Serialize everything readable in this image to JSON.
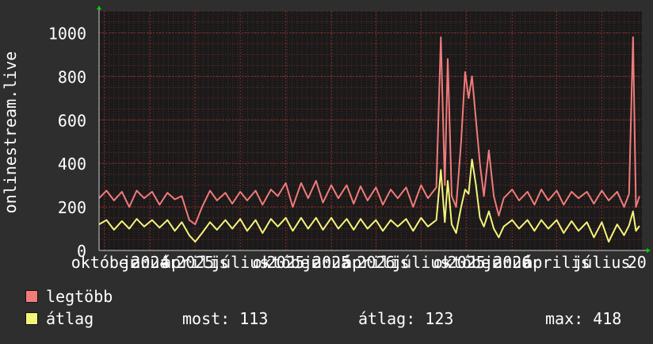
{
  "chart_data": {
    "type": "line",
    "ylabel": "onlinestream.live",
    "ylim": [
      0,
      1100
    ],
    "yticks": [
      0,
      200,
      400,
      600,
      800,
      1000
    ],
    "xlim": [
      "2023-09-20",
      "2026-09-20"
    ],
    "xtick_labels": [
      {
        "date": "2023-10-01",
        "label": "október"
      },
      {
        "date": "2024-01-01",
        "label": "január"
      },
      {
        "date": "2024-04-01",
        "label": "április"
      },
      {
        "date": "2024-07-01",
        "label": "július"
      },
      {
        "date": "2024-10-01",
        "label": "október"
      },
      {
        "date": "2025-01-01",
        "label": "január"
      },
      {
        "date": "2025-04-01",
        "label": "április"
      },
      {
        "date": "2025-07-01",
        "label": "július"
      },
      {
        "date": "2025-10-01",
        "label": "október"
      },
      {
        "date": "2026-01-01",
        "label": "január"
      },
      {
        "date": "2026-04-01",
        "label": "április"
      },
      {
        "date": "2026-07-01",
        "label": "július"
      }
    ],
    "year_labels": [
      {
        "date": "2024-01-01",
        "label": "2024"
      },
      {
        "date": "2025-01-01",
        "label": "2025"
      },
      {
        "date": "2026-01-01",
        "label": "2026"
      },
      {
        "date": "2024-04-01",
        "label": "2025"
      },
      {
        "date": "2025-04-01",
        "label": "2026"
      },
      {
        "date": "2025-10-01",
        "label": "2025"
      },
      {
        "date": "2024-10-01",
        "label": "2025"
      },
      {
        "date": "2026-09-10",
        "label": "20"
      }
    ],
    "grid": true,
    "series": [
      {
        "name": "legtöbb",
        "color": "#f07b7b",
        "points": [
          [
            "2023-09-20",
            240
          ],
          [
            "2023-10-05",
            275
          ],
          [
            "2023-10-20",
            230
          ],
          [
            "2023-11-05",
            270
          ],
          [
            "2023-11-20",
            200
          ],
          [
            "2023-12-05",
            275
          ],
          [
            "2023-12-20",
            240
          ],
          [
            "2024-01-05",
            270
          ],
          [
            "2024-01-20",
            210
          ],
          [
            "2024-02-05",
            265
          ],
          [
            "2024-02-20",
            235
          ],
          [
            "2024-03-05",
            250
          ],
          [
            "2024-03-20",
            140
          ],
          [
            "2024-04-01",
            120
          ],
          [
            "2024-04-15",
            200
          ],
          [
            "2024-05-01",
            275
          ],
          [
            "2024-05-15",
            230
          ],
          [
            "2024-06-01",
            265
          ],
          [
            "2024-06-15",
            215
          ],
          [
            "2024-07-01",
            270
          ],
          [
            "2024-07-15",
            230
          ],
          [
            "2024-08-01",
            275
          ],
          [
            "2024-08-15",
            210
          ],
          [
            "2024-09-01",
            280
          ],
          [
            "2024-09-15",
            250
          ],
          [
            "2024-10-01",
            310
          ],
          [
            "2024-10-15",
            200
          ],
          [
            "2024-11-01",
            310
          ],
          [
            "2024-11-15",
            240
          ],
          [
            "2024-12-01",
            320
          ],
          [
            "2024-12-15",
            220
          ],
          [
            "2025-01-01",
            300
          ],
          [
            "2025-01-15",
            240
          ],
          [
            "2025-02-01",
            300
          ],
          [
            "2025-02-15",
            215
          ],
          [
            "2025-03-01",
            295
          ],
          [
            "2025-03-15",
            230
          ],
          [
            "2025-04-01",
            290
          ],
          [
            "2025-04-15",
            210
          ],
          [
            "2025-05-01",
            280
          ],
          [
            "2025-05-15",
            240
          ],
          [
            "2025-06-01",
            290
          ],
          [
            "2025-06-15",
            200
          ],
          [
            "2025-07-01",
            300
          ],
          [
            "2025-07-15",
            240
          ],
          [
            "2025-08-01",
            290
          ],
          [
            "2025-08-10",
            980
          ],
          [
            "2025-08-18",
            300
          ],
          [
            "2025-08-24",
            880
          ],
          [
            "2025-09-01",
            250
          ],
          [
            "2025-09-10",
            200
          ],
          [
            "2025-09-20",
            500
          ],
          [
            "2025-09-28",
            820
          ],
          [
            "2025-10-05",
            700
          ],
          [
            "2025-10-12",
            800
          ],
          [
            "2025-10-20",
            600
          ],
          [
            "2025-10-28",
            400
          ],
          [
            "2025-11-05",
            250
          ],
          [
            "2025-11-15",
            460
          ],
          [
            "2025-11-25",
            250
          ],
          [
            "2025-12-05",
            160
          ],
          [
            "2025-12-15",
            240
          ],
          [
            "2026-01-01",
            280
          ],
          [
            "2026-01-15",
            230
          ],
          [
            "2026-02-01",
            270
          ],
          [
            "2026-02-15",
            210
          ],
          [
            "2026-03-01",
            280
          ],
          [
            "2026-03-15",
            230
          ],
          [
            "2026-04-01",
            275
          ],
          [
            "2026-04-15",
            210
          ],
          [
            "2026-05-01",
            270
          ],
          [
            "2026-05-15",
            240
          ],
          [
            "2026-06-01",
            270
          ],
          [
            "2026-06-15",
            215
          ],
          [
            "2026-07-01",
            275
          ],
          [
            "2026-07-15",
            230
          ],
          [
            "2026-08-01",
            270
          ],
          [
            "2026-08-15",
            200
          ],
          [
            "2026-08-25",
            260
          ],
          [
            "2026-09-02",
            980
          ],
          [
            "2026-09-08",
            200
          ],
          [
            "2026-09-15",
            250
          ]
        ]
      },
      {
        "name": "átlag",
        "color": "#f4f47a",
        "points": [
          [
            "2023-09-20",
            120
          ],
          [
            "2023-10-05",
            140
          ],
          [
            "2023-10-20",
            95
          ],
          [
            "2023-11-05",
            135
          ],
          [
            "2023-11-20",
            100
          ],
          [
            "2023-12-05",
            145
          ],
          [
            "2023-12-20",
            110
          ],
          [
            "2024-01-05",
            140
          ],
          [
            "2024-01-20",
            105
          ],
          [
            "2024-02-05",
            140
          ],
          [
            "2024-02-20",
            90
          ],
          [
            "2024-03-05",
            130
          ],
          [
            "2024-03-20",
            70
          ],
          [
            "2024-04-01",
            40
          ],
          [
            "2024-04-15",
            80
          ],
          [
            "2024-05-01",
            130
          ],
          [
            "2024-05-15",
            95
          ],
          [
            "2024-06-01",
            140
          ],
          [
            "2024-06-15",
            100
          ],
          [
            "2024-07-01",
            145
          ],
          [
            "2024-07-15",
            90
          ],
          [
            "2024-08-01",
            140
          ],
          [
            "2024-08-15",
            80
          ],
          [
            "2024-09-01",
            145
          ],
          [
            "2024-09-15",
            110
          ],
          [
            "2024-10-01",
            150
          ],
          [
            "2024-10-15",
            90
          ],
          [
            "2024-11-01",
            150
          ],
          [
            "2024-11-15",
            100
          ],
          [
            "2024-12-01",
            150
          ],
          [
            "2024-12-15",
            95
          ],
          [
            "2025-01-01",
            150
          ],
          [
            "2025-01-15",
            100
          ],
          [
            "2025-02-01",
            145
          ],
          [
            "2025-02-15",
            95
          ],
          [
            "2025-03-01",
            145
          ],
          [
            "2025-03-15",
            100
          ],
          [
            "2025-04-01",
            140
          ],
          [
            "2025-04-15",
            90
          ],
          [
            "2025-05-01",
            140
          ],
          [
            "2025-05-15",
            110
          ],
          [
            "2025-06-01",
            145
          ],
          [
            "2025-06-15",
            90
          ],
          [
            "2025-07-01",
            150
          ],
          [
            "2025-07-15",
            110
          ],
          [
            "2025-08-01",
            140
          ],
          [
            "2025-08-10",
            370
          ],
          [
            "2025-08-18",
            130
          ],
          [
            "2025-08-24",
            320
          ],
          [
            "2025-09-01",
            120
          ],
          [
            "2025-09-10",
            80
          ],
          [
            "2025-09-20",
            200
          ],
          [
            "2025-09-28",
            280
          ],
          [
            "2025-10-05",
            260
          ],
          [
            "2025-10-12",
            418
          ],
          [
            "2025-10-20",
            300
          ],
          [
            "2025-10-28",
            150
          ],
          [
            "2025-11-05",
            110
          ],
          [
            "2025-11-15",
            180
          ],
          [
            "2025-11-25",
            100
          ],
          [
            "2025-12-05",
            60
          ],
          [
            "2025-12-15",
            110
          ],
          [
            "2026-01-01",
            140
          ],
          [
            "2026-01-15",
            100
          ],
          [
            "2026-02-01",
            140
          ],
          [
            "2026-02-15",
            90
          ],
          [
            "2026-03-01",
            140
          ],
          [
            "2026-03-15",
            100
          ],
          [
            "2026-04-01",
            140
          ],
          [
            "2026-04-15",
            80
          ],
          [
            "2026-05-01",
            135
          ],
          [
            "2026-05-15",
            90
          ],
          [
            "2026-06-01",
            130
          ],
          [
            "2026-06-15",
            60
          ],
          [
            "2026-07-01",
            130
          ],
          [
            "2026-07-15",
            40
          ],
          [
            "2026-08-01",
            120
          ],
          [
            "2026-08-15",
            70
          ],
          [
            "2026-08-25",
            115
          ],
          [
            "2026-09-02",
            180
          ],
          [
            "2026-09-08",
            90
          ],
          [
            "2026-09-15",
            113
          ]
        ]
      }
    ]
  },
  "legend": {
    "max_label": "legtöbb",
    "avg_label": "átlag",
    "max_color": "#f07b7b",
    "avg_color": "#f4f47a"
  },
  "stats": {
    "current": "most: 113",
    "average": "átlag: 123",
    "maximum": "max: 418"
  },
  "colors": {
    "background": "#2e2e2e",
    "plot_background": "#1a1a1a",
    "grid": "#8a2e2e",
    "axis_arrow": "#00d000"
  }
}
